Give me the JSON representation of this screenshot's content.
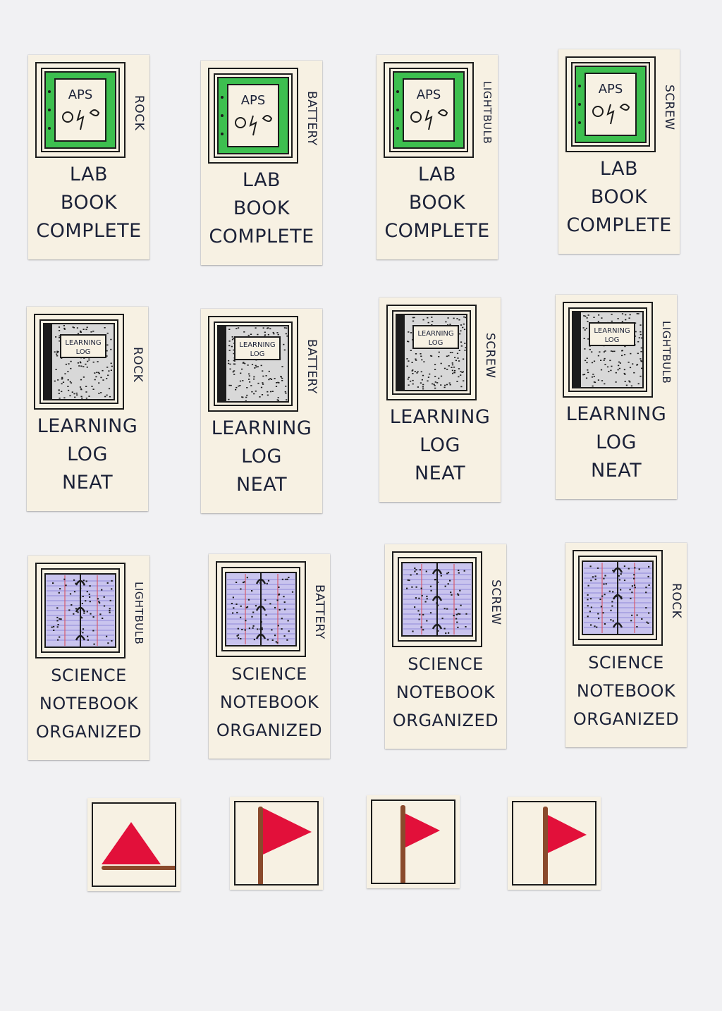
{
  "cards": [
    {
      "side": "ROCK",
      "lines": [
        "LAB",
        "BOOK",
        "COMPLETE"
      ],
      "icon": "lab-book-icon"
    },
    {
      "side": "BATTERY",
      "lines": [
        "LAB",
        "BOOK",
        "COMPLETE"
      ],
      "icon": "lab-book-icon"
    },
    {
      "side": "LIGHTBULB",
      "lines": [
        "LAB",
        "BOOK",
        "COMPLETE"
      ],
      "icon": "lab-book-icon"
    },
    {
      "side": "SCREW",
      "lines": [
        "LAB",
        "BOOK",
        "COMPLETE"
      ],
      "icon": "lab-book-icon"
    },
    {
      "side": "ROCK",
      "lines": [
        "LEARNING",
        "LOG",
        "NEAT"
      ],
      "icon": "composition-notebook-icon"
    },
    {
      "side": "BATTERY",
      "lines": [
        "LEARNING",
        "LOG",
        "NEAT"
      ],
      "icon": "composition-notebook-icon"
    },
    {
      "side": "SCREW",
      "lines": [
        "LEARNING",
        "LOG",
        "NEAT"
      ],
      "icon": "composition-notebook-icon"
    },
    {
      "side": "LIGHTBULB",
      "lines": [
        "LEARNING",
        "LOG",
        "NEAT"
      ],
      "icon": "composition-notebook-icon"
    },
    {
      "side": "LIGHTBULB",
      "lines": [
        "SCIENCE",
        "NOTEBOOK",
        "ORGANIZED"
      ],
      "icon": "spiral-notebook-icon"
    },
    {
      "side": "BATTERY",
      "lines": [
        "SCIENCE",
        "NOTEBOOK",
        "ORGANIZED"
      ],
      "icon": "spiral-notebook-icon"
    },
    {
      "side": "SCREW",
      "lines": [
        "SCIENCE",
        "NOTEBOOK",
        "ORGANIZED"
      ],
      "icon": "spiral-notebook-icon"
    },
    {
      "side": "ROCK",
      "lines": [
        "SCIENCE",
        "NOTEBOOK",
        "ORGANIZED"
      ],
      "icon": "spiral-notebook-icon"
    }
  ],
  "lab_book_cover": {
    "title": "APS"
  },
  "learning_log_cover": {
    "line1": "LEARNING",
    "line2": "LOG"
  },
  "tiles": [
    {
      "icon": "fallen-flag-icon"
    },
    {
      "icon": "raised-flag-icon"
    },
    {
      "icon": "raised-flag-icon"
    },
    {
      "icon": "raised-flag-icon"
    }
  ],
  "colors": {
    "paper": "#f7f1e3",
    "ink": "#1c2238",
    "green": "#3dbf4f",
    "flag_red": "#e2103a",
    "pole_brown": "#8a4a2c",
    "lined_blue": "#b9b3ea"
  }
}
